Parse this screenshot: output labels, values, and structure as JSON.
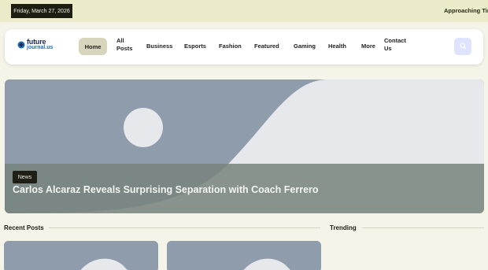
{
  "topbar": {
    "date": "Friday, March 27, 2026",
    "ticker": "Approaching Tim"
  },
  "logo": {
    "line1": "future",
    "line2": "journal.us"
  },
  "nav": {
    "items": [
      {
        "label": "Home"
      },
      {
        "label": "All Posts"
      },
      {
        "label": "Business"
      },
      {
        "label": "Esports"
      },
      {
        "label": "Fashion"
      },
      {
        "label": "Featured"
      },
      {
        "label": "Gaming"
      },
      {
        "label": "Health"
      },
      {
        "label": "More"
      },
      {
        "label": "Contact Us"
      }
    ],
    "all_posts_line1": "All",
    "all_posts_line2": "Posts",
    "contact_line1": "Contact",
    "contact_line2": "Us",
    "active": "Home"
  },
  "hero": {
    "category": "News",
    "title": "Carlos Alcaraz Reveals Surprising Separation with Coach Ferrero"
  },
  "sections": {
    "recent": "Recent Posts",
    "trending": "Trending"
  },
  "colors": {
    "accent": "#dfe3ff",
    "placeholder": "#8f9cab",
    "topbar": "#ebebca"
  },
  "icons": {
    "search": "search-icon",
    "logo": "logo-icon"
  }
}
